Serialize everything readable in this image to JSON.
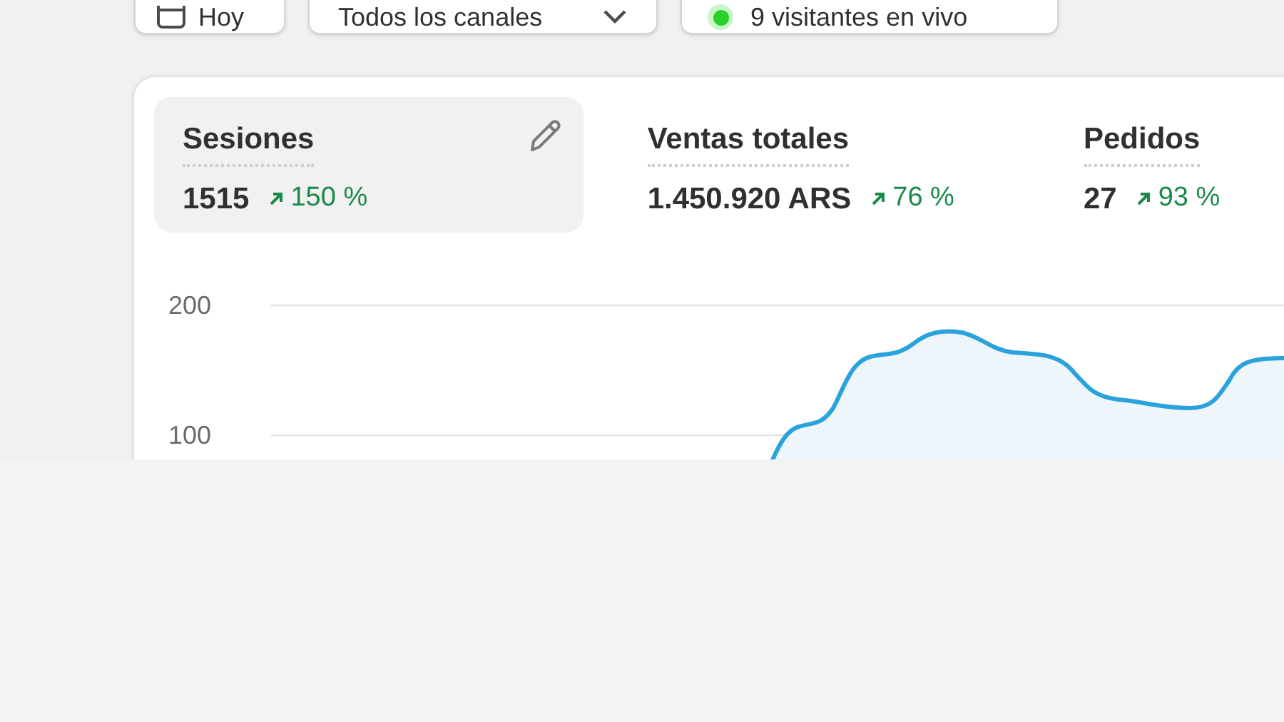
{
  "filters": [
    {
      "kind": "date",
      "label": "Hoy"
    },
    {
      "kind": "select",
      "label": "Todos los canales"
    },
    {
      "kind": "live",
      "label": "9 visitantes en vivo"
    }
  ],
  "metrics": [
    {
      "label": "Sesiones",
      "value": "1515",
      "change": "150 %",
      "selected": true
    },
    {
      "label": "Ventas totales",
      "value": "1.450.920 ARS",
      "change": "76 %",
      "selected": false
    },
    {
      "label": "Pedidos",
      "value": "27",
      "change": "93 %",
      "selected": false
    }
  ],
  "chart": {
    "y_axis_labels": [
      "200",
      "100"
    ]
  }
}
